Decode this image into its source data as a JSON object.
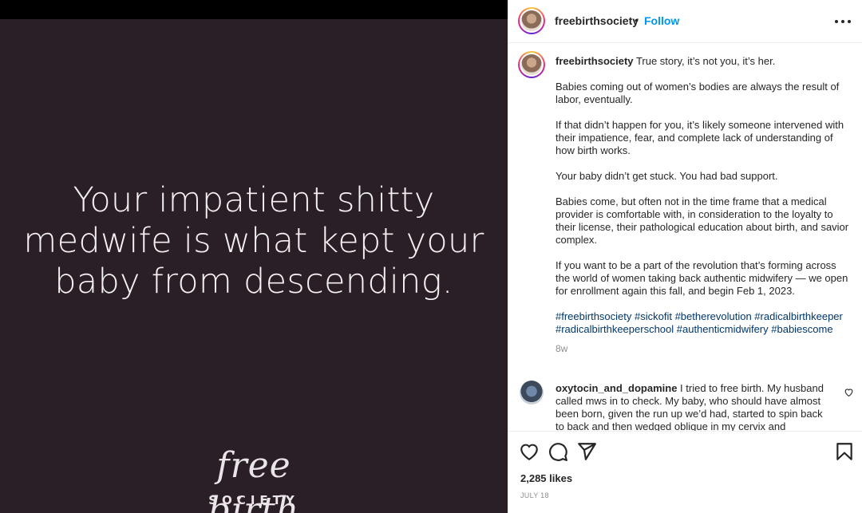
{
  "image_post": {
    "quote_lines": [
      "Your impatient shitty",
      "medwife is what kept your",
      "baby from descending."
    ],
    "logo_script": "free birth",
    "logo_word": "SOCIETY"
  },
  "header": {
    "username": "freebirthsociety",
    "separator": "•",
    "follow_label": "Follow"
  },
  "caption": {
    "username": "freebirthsociety",
    "first_line": "True story, it’s not you, it’s her.",
    "paragraphs": [
      "Babies coming out of women’s bodies are always the result of labor, eventually.",
      "If that didn’t happen for you, it’s likely someone intervened with their impatience, fear, and complete lack of understanding of how birth works.",
      "Your baby didn’t get stuck. You had bad support.",
      "Babies come, but often not in the time frame that a medical provider is comfortable with, in consideration to the loyalty to their license, their pathological education about birth, and savior complex.",
      "If you want to be a part of the revolution that’s forming across the world of women taking back authentic midwifery — we open for enrollment again this fall, and begin Feb 1, 2023."
    ],
    "hashtags": "#freebirthsociety #sickofit #betherevolution #radicalbirthkeeper #radicalbirthkeeperschool #authenticmidwifery #babiescome",
    "age": "8w"
  },
  "comment": {
    "username": "oxytocin_and_dopamine",
    "text": "I tried to free birth. My husband called mws in to check. My baby, who should have almost been born, given the run up we’d had, started to spin back to back and then wedged oblique in my cervix and remained"
  },
  "actions": {
    "likes": "2,285 likes",
    "date": "JULY 18"
  },
  "icons": {
    "like": "heart-icon",
    "comment": "comment-icon",
    "share": "share-icon",
    "save": "bookmark-icon",
    "more": "more-options-icon"
  },
  "colors": {
    "media_bg": "#2b1f27",
    "follow": "#0095f6",
    "hashtag": "#00376b",
    "muted": "#8e8e8e"
  }
}
